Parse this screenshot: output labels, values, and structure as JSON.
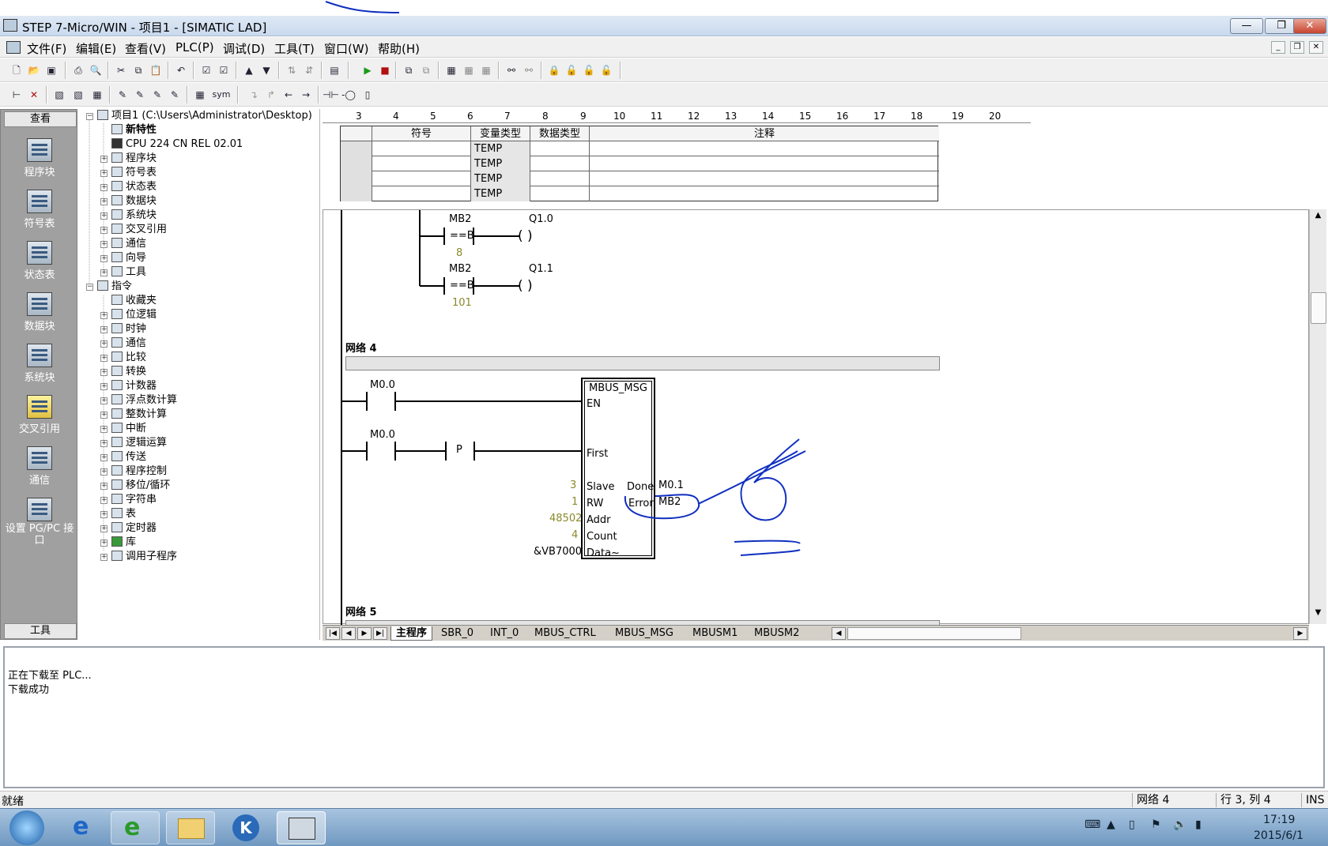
{
  "window": {
    "title": "STEP 7-Micro/WIN - 项目1 - [SIMATIC LAD]",
    "min_label": "—",
    "restore_label": "❐",
    "close_label": "✕"
  },
  "menu": [
    "文件(F)",
    "编辑(E)",
    "查看(V)",
    "PLC(P)",
    "调试(D)",
    "工具(T)",
    "窗口(W)",
    "帮助(H)"
  ],
  "toolbar2": {
    "sym_label": "sym"
  },
  "navbar": {
    "header": "查看",
    "footer": "工具",
    "items": [
      "程序块",
      "符号表",
      "状态表",
      "数据块",
      "系统块",
      "交叉引用",
      "通信",
      "设置 PG/PC 接口"
    ]
  },
  "tree": {
    "root": "项目1 (C:\\Users\\Administrator\\Desktop)",
    "project_items": [
      "新特性",
      "CPU 224 CN REL 02.01",
      "程序块",
      "符号表",
      "状态表",
      "数据块",
      "系统块",
      "交叉引用",
      "通信",
      "向导",
      "工具"
    ],
    "instructions_label": "指令",
    "instruction_items": [
      "收藏夹",
      "位逻辑",
      "时钟",
      "通信",
      "比较",
      "转换",
      "计数器",
      "浮点数计算",
      "整数计算",
      "中断",
      "逻辑运算",
      "传送",
      "程序控制",
      "移位/循环",
      "字符串",
      "表",
      "定时器",
      "库",
      "调用子程序"
    ]
  },
  "ruler": [
    "3",
    "4",
    "5",
    "6",
    "7",
    "8",
    "9",
    "10",
    "11",
    "12",
    "13",
    "14",
    "15",
    "16",
    "17",
    "18",
    "19",
    "20"
  ],
  "var_table": {
    "headers": [
      "符号",
      "变量类型",
      "数据类型",
      "注释"
    ],
    "rows": [
      "TEMP",
      "TEMP",
      "TEMP",
      "TEMP"
    ]
  },
  "ladder": {
    "net3_c1_addr": "MB2",
    "net3_c1_op": "==B",
    "net3_c1_value": "8",
    "net3_coil1": "Q1.0",
    "net3_c2_addr": "MB2",
    "net3_c2_op": "==B",
    "net3_c2_value": "101",
    "net3_coil2": "Q1.1",
    "coil_symbol": "(      )",
    "net4_title": "网络 4",
    "net4_contact1": "M0.0",
    "net4_contact2": "M0.0",
    "pos_edge": "P",
    "block_name": "MBUS_MSG",
    "pins_left": [
      "EN",
      "First",
      "Slave",
      "RW",
      "Addr",
      "Count",
      "Data~"
    ],
    "pins_right": [
      "Done",
      "Error"
    ],
    "inputs": [
      "3",
      "1",
      "48502",
      "4",
      "&VB7000"
    ],
    "outputs": [
      "M0.1",
      "MB2"
    ],
    "net5_title": "网络 5"
  },
  "tabs": [
    "主程序",
    "SBR_0",
    "INT_0",
    "MBUS_CTRL",
    "MBUS_MSG",
    "MBUSM1",
    "MBUSM2"
  ],
  "output": [
    "正在下载至 PLC...",
    "下载成功"
  ],
  "status": {
    "ready": "就绪",
    "network": "网络 4",
    "position": "行 3, 列 4",
    "mode": "INS"
  },
  "taskbar": {
    "time": "17:19",
    "date": "2015/6/1",
    "ie_glyph": "e",
    "k_glyph": "K"
  },
  "colors": {
    "annotation_blue": "#1030c0",
    "value_olive": "#8a8a2a",
    "nav_bg": "#a0a0a0"
  }
}
